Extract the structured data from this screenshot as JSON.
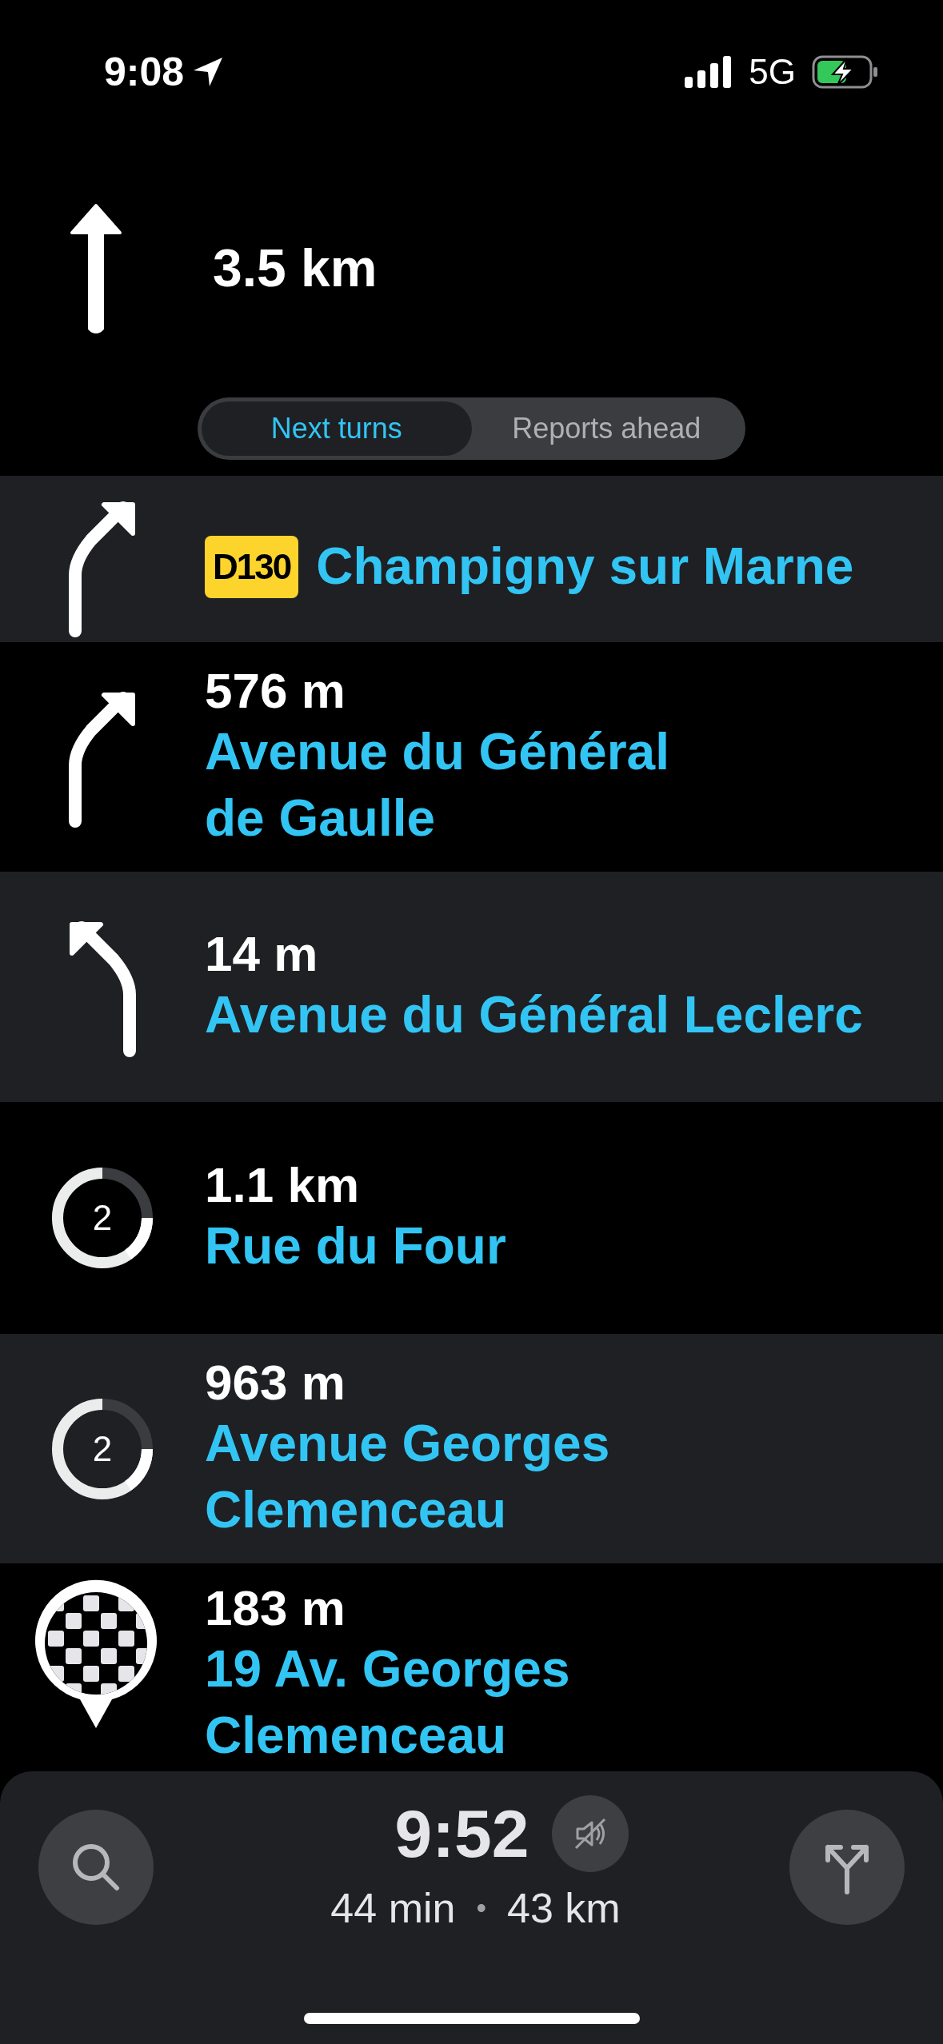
{
  "status_bar": {
    "time": "9:08",
    "network": "5G"
  },
  "header": {
    "distance": "3.5 km"
  },
  "tabs": [
    {
      "label": "Next turns",
      "selected": true
    },
    {
      "label": "Reports ahead",
      "selected": false
    }
  ],
  "turns": [
    {
      "kind": "bear-right",
      "road": "D130",
      "street": "Champigny sur Marne"
    },
    {
      "kind": "bear-right",
      "distance": "576 m",
      "street": "Avenue du Général de Gaulle"
    },
    {
      "kind": "bear-left",
      "distance": "14 m",
      "street": "Avenue du Général Leclerc"
    },
    {
      "kind": "roundabout",
      "exit": "2",
      "distance": "1.1 km",
      "street": "Rue du Four"
    },
    {
      "kind": "roundabout",
      "exit": "2",
      "distance": "963 m",
      "street": "Avenue Georges Clemenceau"
    },
    {
      "kind": "finish",
      "distance": "183 m",
      "street": "19 Av. Georges Clemenceau"
    }
  ],
  "footer": {
    "eta": "9:52",
    "duration": "44 min",
    "separator": "•",
    "distance": "43 km"
  }
}
